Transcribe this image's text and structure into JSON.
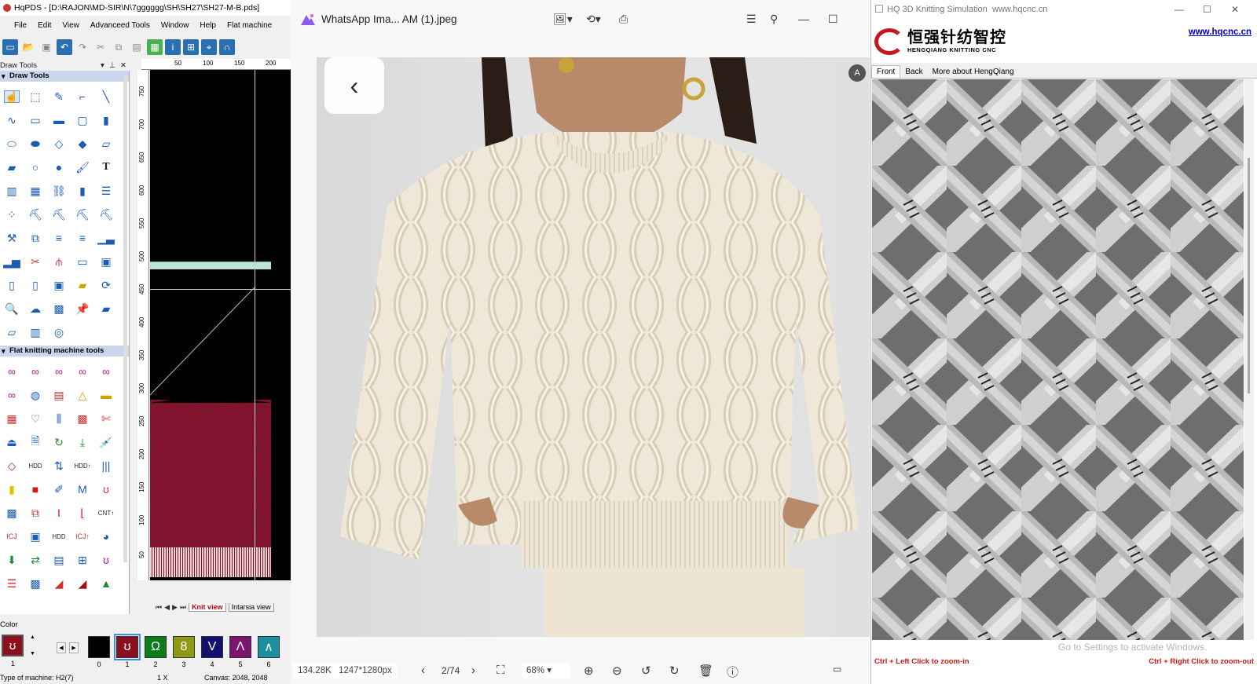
{
  "hqpds": {
    "title": "HqPDS - [D:\\RAJON\\MD-SIR\\N\\7gggggg\\SH\\SH27\\SH27-M-B.pds]",
    "menu": [
      "File",
      "Edit",
      "View",
      "Advanceed Tools",
      "Window",
      "Help",
      "Flat machine"
    ],
    "draw_tools_header": "Draw Tools",
    "draw_tools_section": "Draw Tools",
    "flat_tools_section": "Flat knitting machine tools",
    "ruler_top": [
      "50",
      "100",
      "150",
      "200"
    ],
    "ruler_left": [
      "750",
      "700",
      "650",
      "600",
      "550",
      "500",
      "450",
      "400",
      "350",
      "300",
      "250",
      "200",
      "150",
      "100",
      "50"
    ],
    "canvas_tabs": {
      "knit": "Knit view",
      "intarsia": "Intarsia view"
    },
    "color_header": "Color",
    "lead_swatch": {
      "glyph": "ʊ",
      "num": "1"
    },
    "swatches": [
      {
        "num": "0",
        "color": "#000000",
        "glyph": ""
      },
      {
        "num": "1",
        "color": "#8c0f1e",
        "glyph": "ʊ"
      },
      {
        "num": "2",
        "color": "#0a7d1a",
        "glyph": "Ω"
      },
      {
        "num": "3",
        "color": "#8f9a14",
        "glyph": "8"
      },
      {
        "num": "4",
        "color": "#12126e",
        "glyph": "V"
      },
      {
        "num": "5",
        "color": "#7b1670",
        "glyph": "Λ"
      },
      {
        "num": "6",
        "color": "#1c8fa0",
        "glyph": "∧"
      }
    ],
    "status": {
      "machine": "Type of machine: H2(7)",
      "zoom": "1 X",
      "canvas": "Canvas: 2048, 2048"
    }
  },
  "photos": {
    "title": "WhatsApp Ima... AM (1).jpeg",
    "file_size": "134.28K",
    "dimensions": "1247*1280px",
    "counter": "2/74",
    "zoom": "68%"
  },
  "sim": {
    "title": "HQ 3D Knitting Simulation",
    "title_url": "www.hqcnc.cn",
    "brand_cn": "恒强针纺智控",
    "brand_en": "HENGQIANG KNITTING CNC",
    "url": "www.hqcnc.cn",
    "tabs": [
      "Front",
      "Back",
      "More about HengQiang"
    ],
    "watermark": "Go to Settings to activate Windows.",
    "hint_left": "Ctrl + Left Click to zoom-in",
    "hint_right": "Ctrl + Right Click to zoom-out"
  }
}
